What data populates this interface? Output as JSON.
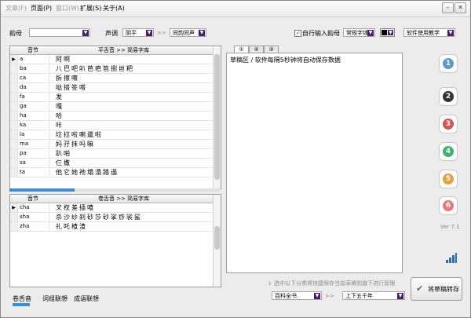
{
  "menu": {
    "items": [
      {
        "label": "文章(F)",
        "disabled": true
      },
      {
        "label": "页面(P)",
        "disabled": false
      },
      {
        "label": "窗口(W)",
        "disabled": true
      },
      {
        "label": "扩展(S)",
        "disabled": false
      },
      {
        "label": "关于(A)",
        "disabled": false
      }
    ]
  },
  "toolbar": {
    "yunmu_label": "韵母",
    "shengdiao_label": "声调",
    "shengdiao_value": "阴平",
    "arrow_text": ">>",
    "tong_value": "同韵同声",
    "auto_input_label": "自行输入韵母",
    "font_value": "常规字体",
    "usage_value": "软件使用教学"
  },
  "grid1": {
    "header_col1": "音节",
    "header_col2": "平舌音 >> 简易字库",
    "rows": [
      {
        "syl": "a",
        "chars": "阿啊"
      },
      {
        "syl": "ba",
        "chars": "八巴吧叭芭疤笆捌岜粑"
      },
      {
        "syl": "ca",
        "chars": "拆擦嚓"
      },
      {
        "syl": "da",
        "chars": "哒搭答嗒"
      },
      {
        "syl": "fa",
        "chars": "发"
      },
      {
        "syl": "ga",
        "chars": "嘎"
      },
      {
        "syl": "ha",
        "chars": "哈"
      },
      {
        "syl": "ka",
        "chars": "咔"
      },
      {
        "syl": "la",
        "chars": "垃拉啦喇邋啦"
      },
      {
        "syl": "ma",
        "chars": "妈孖抹吗嘛"
      },
      {
        "syl": "pa",
        "chars": "趴啪"
      },
      {
        "syl": "sa",
        "chars": "仨撒"
      },
      {
        "syl": "ta",
        "chars": "他它她祂塌溻踏遢"
      }
    ]
  },
  "grid2": {
    "header_col1": "音节",
    "header_col2": "卷舌音 >> 简易字库",
    "rows": [
      {
        "syl": "cha",
        "chars": "叉杈差插喳"
      },
      {
        "syl": "sha",
        "chars": "杀沙纱刹砂莎砂挲痧裟鲨"
      },
      {
        "syl": "zha",
        "chars": "扎吒楂渣"
      }
    ]
  },
  "tabs": [
    "①",
    "②",
    "③"
  ],
  "draft_text": "草稿区 / 软件每隔5秒钟将自动保存数据",
  "version": "Ver 7.1",
  "hint": "↓ 选中以下分类将快捷保存当前草稿到旗下进行管理",
  "category1": "百科全书",
  "category2": "上下五千年",
  "save_label": "将草稿转存",
  "bottom_tabs": [
    "卷舌音",
    "词组联想",
    "成语联想"
  ],
  "circle_buttons": [
    {
      "icon": "number-one-icon",
      "text": "1",
      "color": "#5b9bd5"
    },
    {
      "icon": "number-two-icon",
      "text": "2",
      "color": "#333333"
    },
    {
      "icon": "number-three-icon",
      "text": "3",
      "color": "#d9534f"
    },
    {
      "icon": "number-four-icon",
      "text": "4",
      "color": "#3cb371"
    },
    {
      "icon": "number-five-icon",
      "text": "5",
      "color": "#e6a23c"
    },
    {
      "icon": "number-six-icon",
      "text": "6",
      "color": "#e8787c"
    }
  ],
  "colors": {
    "accent": "#4b1a6e",
    "progress": "#3b8fd6"
  }
}
